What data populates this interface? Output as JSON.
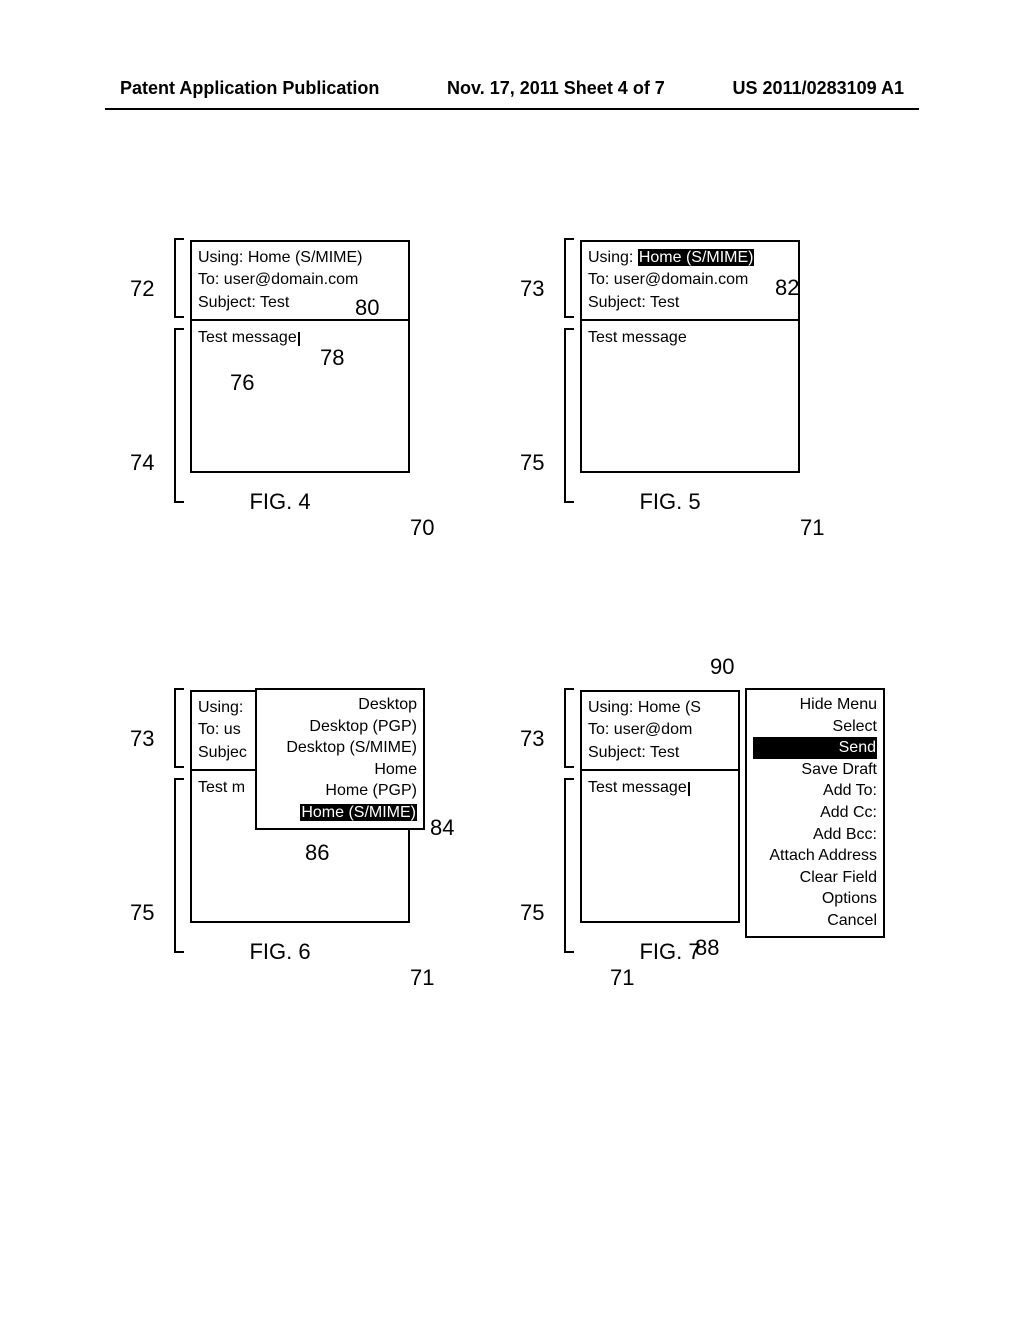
{
  "header": {
    "left": "Patent Application Publication",
    "mid": "Nov. 17, 2011  Sheet 4 of 7",
    "right": "US 2011/0283109 A1"
  },
  "fig4": {
    "label": "FIG. 4",
    "using_label": "Using:",
    "using_value": "Home (S/MIME)",
    "to_label": "To:",
    "to_value": "user@domain.com",
    "subject_label": "Subject:",
    "subject_value": "Test",
    "body": "Test message",
    "ref_72": "72",
    "ref_74": "74",
    "ref_70": "70",
    "ref_76": "76",
    "ref_78": "78",
    "ref_80": "80"
  },
  "fig5": {
    "label": "FIG. 5",
    "using_label": "Using:",
    "using_value": "Home (S/MIME)",
    "to_label": "To:",
    "to_value": "user@domain.com",
    "subject_label": "Subject:",
    "subject_value": "Test",
    "body": "Test message",
    "ref_73": "73",
    "ref_75": "75",
    "ref_71": "71",
    "ref_82": "82"
  },
  "fig6": {
    "label": "FIG. 6",
    "using_label": "Using:",
    "to_label": "To: us",
    "subject_label": "Subjec",
    "body": "Test m",
    "options": [
      "Desktop",
      "Desktop (PGP)",
      "Desktop (S/MIME)",
      "Home",
      "Home (PGP)",
      "Home (S/MIME)"
    ],
    "ref_73": "73",
    "ref_75": "75",
    "ref_71": "71",
    "ref_84": "84",
    "ref_86": "86"
  },
  "fig7": {
    "label": "FIG. 7",
    "using_label": "Using:",
    "using_value": "Home (S",
    "to_label": "To:",
    "to_value": "user@dom",
    "subject_label": "Subject:",
    "subject_value": "Test",
    "body": "Test message",
    "menu": [
      "Hide Menu",
      "Select",
      "Send",
      "Save Draft",
      "Add To:",
      "Add Cc:",
      "Add Bcc:",
      "Attach Address",
      "Clear Field",
      "Options",
      "Cancel"
    ],
    "ref_73": "73",
    "ref_75": "75",
    "ref_71": "71",
    "ref_88": "88",
    "ref_90": "90"
  }
}
